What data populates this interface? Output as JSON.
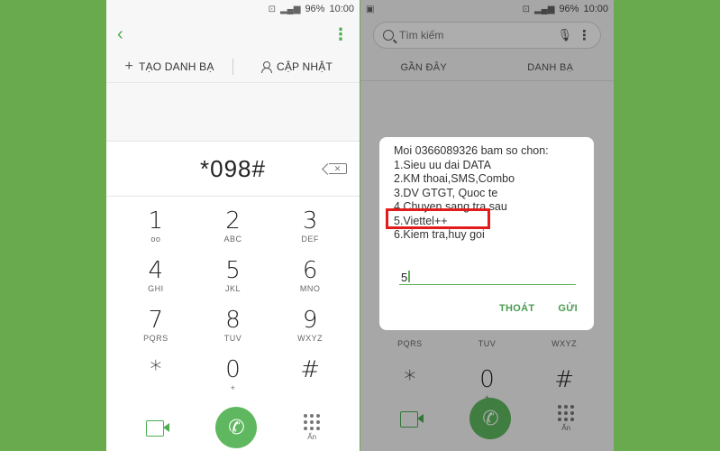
{
  "status": {
    "battery": "96%",
    "time": "10:00"
  },
  "left": {
    "actions": {
      "create_contact": "TẠO DANH BẠ",
      "update": "CẬP NHẬT"
    },
    "number": "*098#",
    "keys": [
      {
        "digit": "1",
        "letters": ""
      },
      {
        "digit": "2",
        "letters": "ABC"
      },
      {
        "digit": "3",
        "letters": "DEF"
      },
      {
        "digit": "4",
        "letters": "GHI"
      },
      {
        "digit": "5",
        "letters": "JKL"
      },
      {
        "digit": "6",
        "letters": "MNO"
      },
      {
        "digit": "7",
        "letters": "PQRS"
      },
      {
        "digit": "8",
        "letters": "TUV"
      },
      {
        "digit": "9",
        "letters": "WXYZ"
      },
      {
        "digit": "*",
        "letters": ""
      },
      {
        "digit": "0",
        "letters": "+"
      },
      {
        "digit": "#",
        "letters": ""
      }
    ],
    "hide_label": "Ẩn"
  },
  "right": {
    "search_placeholder": "Tìm kiếm",
    "tabs": [
      "GẦN ĐÂY",
      "DANH BẠ"
    ],
    "background_keys": [
      {
        "digit": "",
        "letters": "PQRS"
      },
      {
        "digit": "",
        "letters": "TUV"
      },
      {
        "digit": "",
        "letters": "WXYZ"
      },
      {
        "digit": "*",
        "letters": ""
      },
      {
        "digit": "0",
        "letters": "+"
      },
      {
        "digit": "#",
        "letters": ""
      }
    ],
    "hide_label": "Ẩn",
    "dialog": {
      "lines": [
        "Moi 0366089326 bam so chon:",
        "1.Sieu uu dai DATA",
        "2.KM thoai,SMS,Combo",
        "3.DV GTGT, Quoc te",
        "4.Chuyen sang tra sau",
        "5.Viettel++",
        "6.Kiem tra,huy goi"
      ],
      "input_value": "5",
      "cancel_label": "THOÁT",
      "send_label": "GỬI",
      "highlight_color": "#e21c1c"
    }
  }
}
